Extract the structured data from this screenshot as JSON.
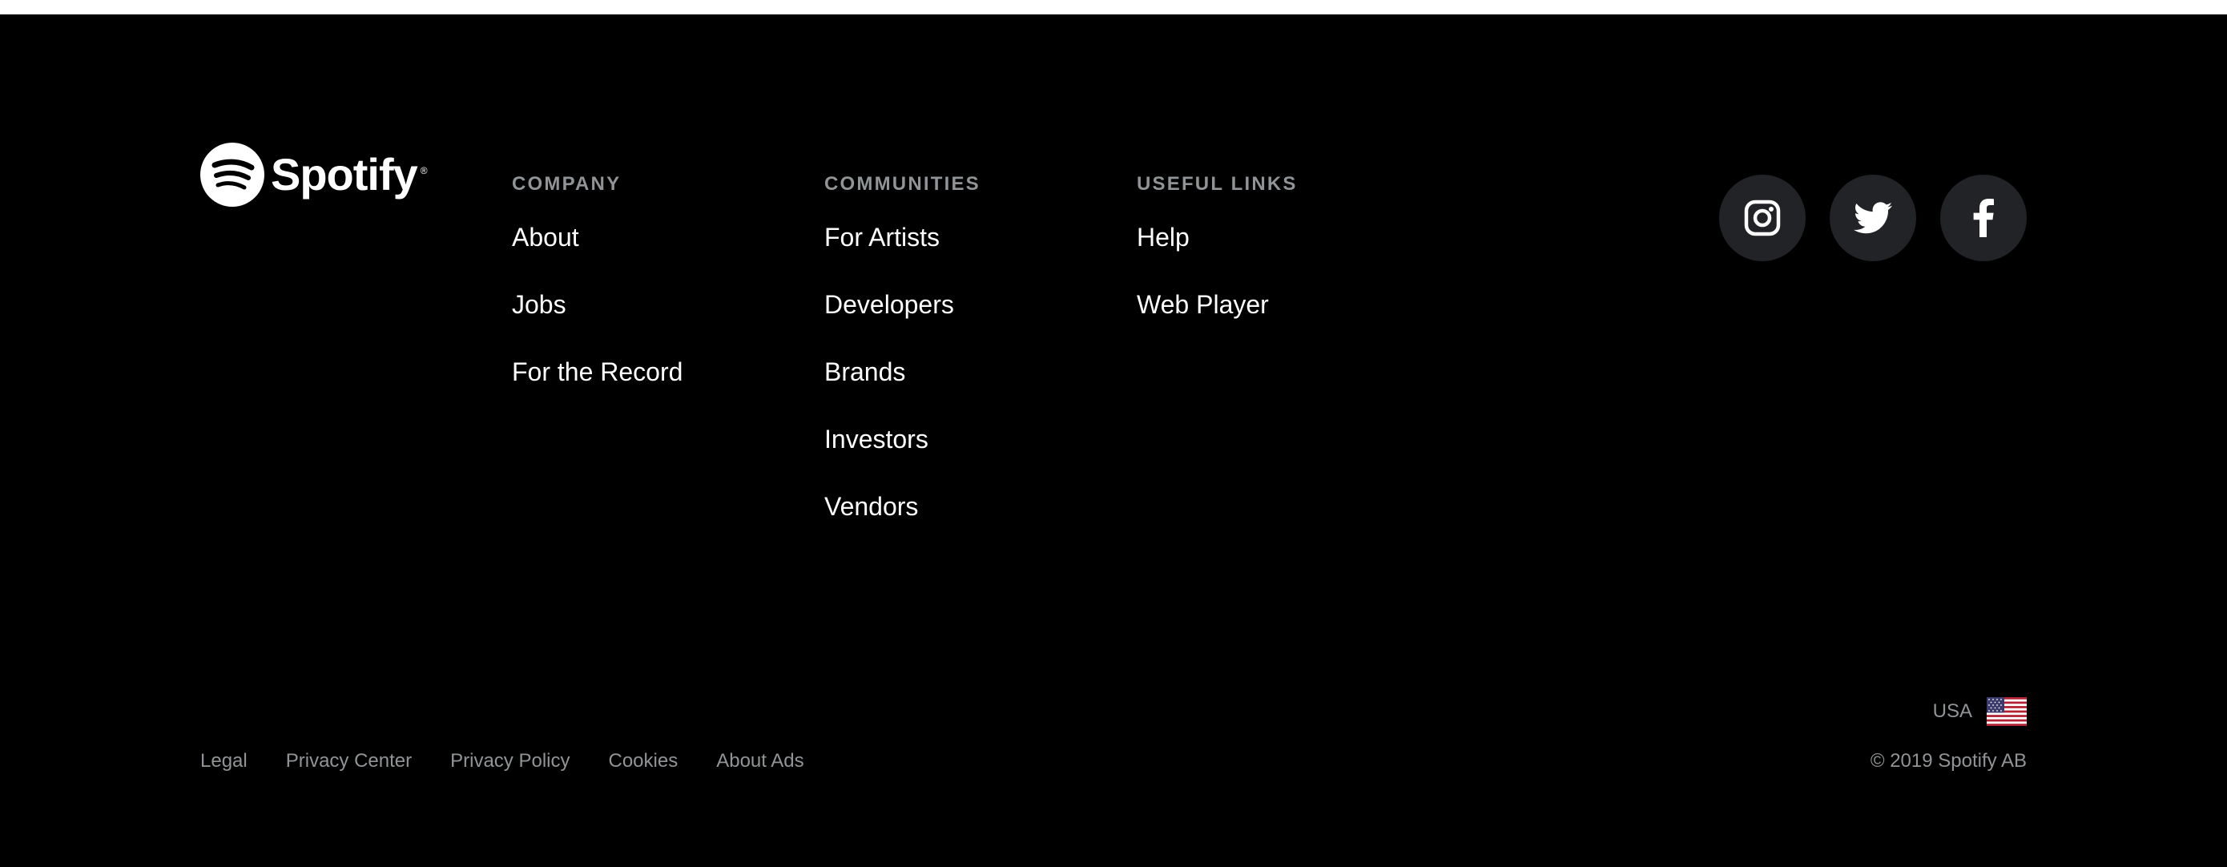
{
  "brand": {
    "name": "Spotify",
    "registered_mark": "®"
  },
  "columns": {
    "company": {
      "heading": "COMPANY",
      "links": [
        "About",
        "Jobs",
        "For the Record"
      ]
    },
    "communities": {
      "heading": "COMMUNITIES",
      "links": [
        "For Artists",
        "Developers",
        "Brands",
        "Investors",
        "Vendors"
      ]
    },
    "useful_links": {
      "heading": "USEFUL LINKS",
      "links": [
        "Help",
        "Web Player"
      ]
    }
  },
  "social": [
    {
      "name": "Instagram",
      "icon": "instagram-icon"
    },
    {
      "name": "Twitter",
      "icon": "twitter-icon"
    },
    {
      "name": "Facebook",
      "icon": "facebook-icon"
    }
  ],
  "bottom_links": [
    "Legal",
    "Privacy Center",
    "Privacy Policy",
    "Cookies",
    "About Ads"
  ],
  "country": {
    "label": "USA",
    "flag_icon": "us-flag-icon"
  },
  "copyright": "© 2019 Spotify AB",
  "colors": {
    "background": "#000000",
    "text": "#ffffff",
    "muted": "#919496",
    "social_button": "#222326"
  }
}
